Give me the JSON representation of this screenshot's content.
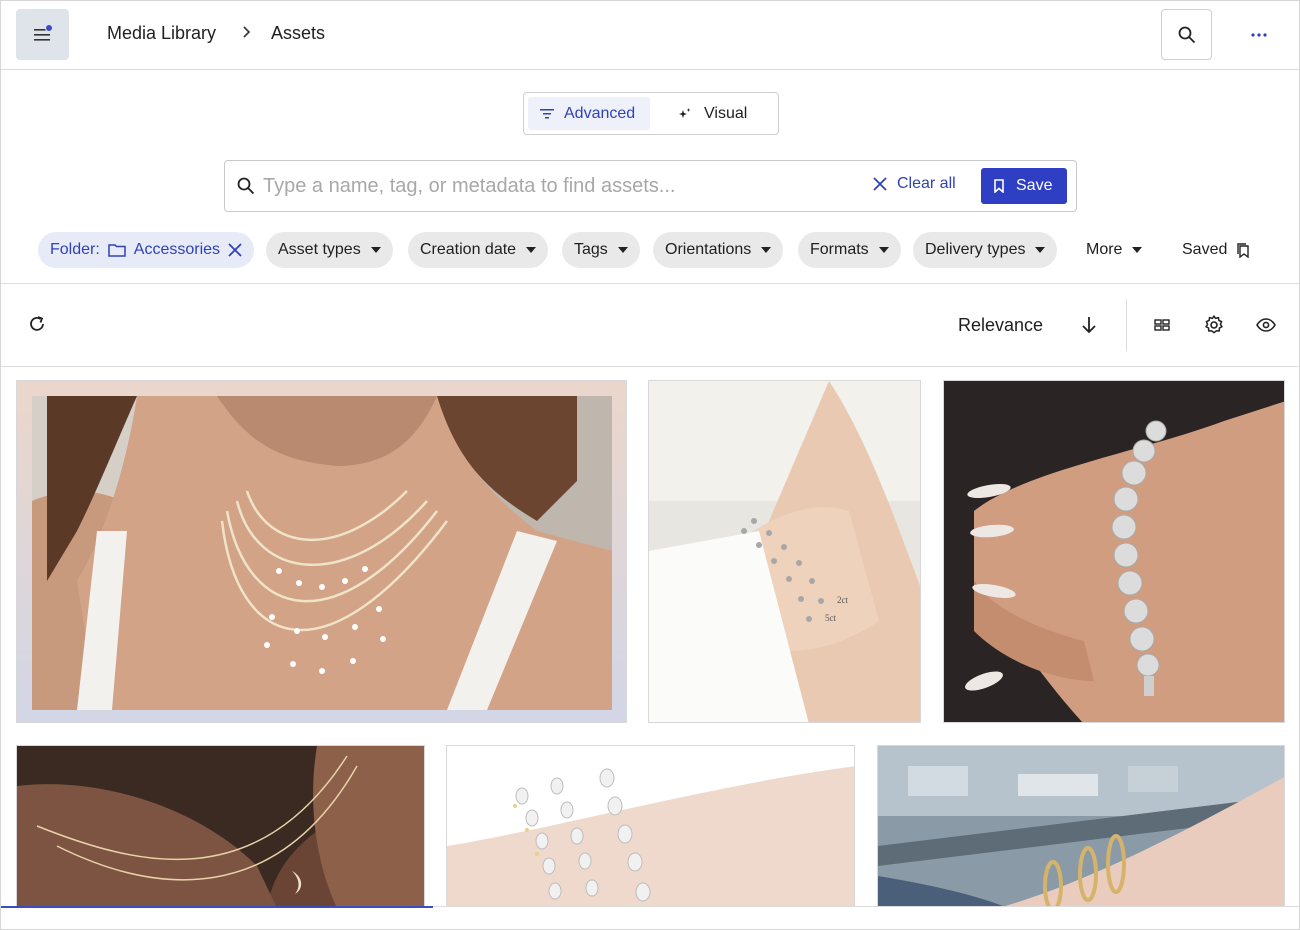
{
  "header": {
    "breadcrumb": [
      "Media Library",
      "Assets"
    ],
    "menu_icon": "hamburger-menu-icon",
    "search_icon": "search-icon",
    "more_icon": "more-horizontal-icon"
  },
  "mode_toggle": {
    "advanced_label": "Advanced",
    "visual_label": "Visual",
    "selected": "Advanced"
  },
  "search": {
    "placeholder": "Type a name, tag, or metadata to find assets...",
    "value": "",
    "clear_label": "Clear all",
    "save_label": "Save"
  },
  "filters": {
    "folder_label": "Folder:",
    "folder_value": "Accessories",
    "chips": [
      "Asset types",
      "Creation date",
      "Tags",
      "Orientations",
      "Formats",
      "Delivery types"
    ],
    "more_label": "More",
    "saved_label": "Saved"
  },
  "toolbar": {
    "sort_label": "Relevance",
    "sort_direction": "descending"
  },
  "assets": {
    "bracelet_labels": [
      "2ct",
      "5ct"
    ]
  },
  "colors": {
    "accent": "#2f3fc4",
    "accent_text": "#3142b8",
    "chip_bg": "#e9e9e9",
    "folder_chip_bg": "#e7eaf7"
  }
}
